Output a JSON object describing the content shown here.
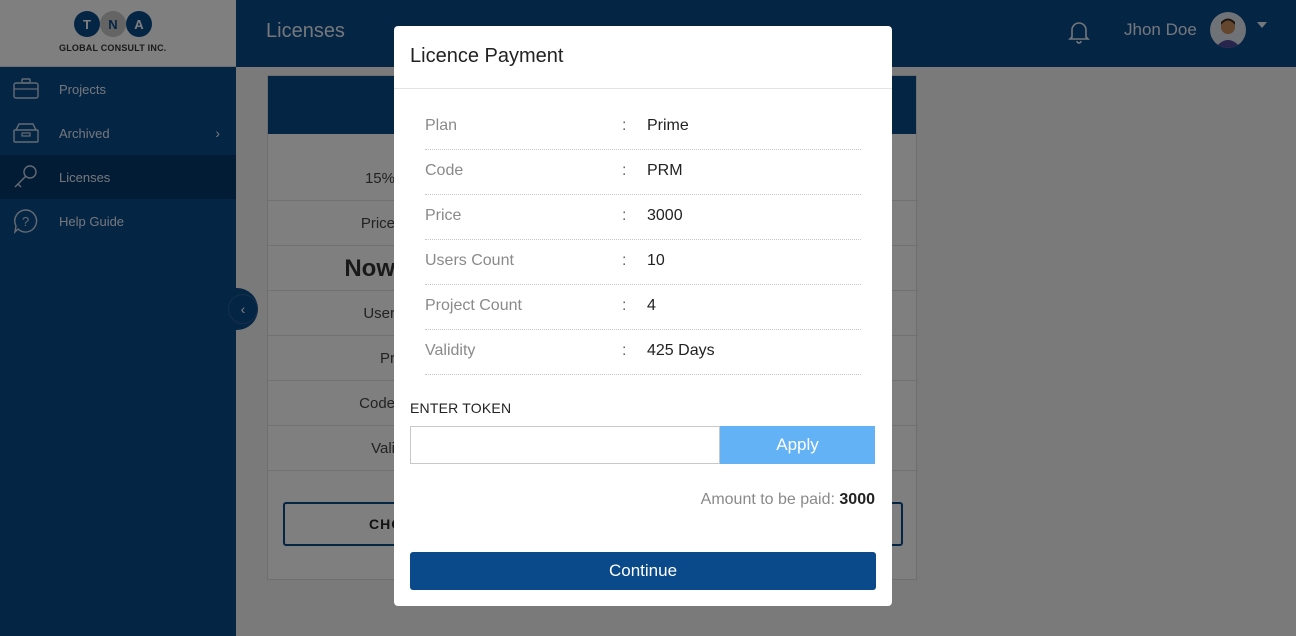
{
  "logo": {
    "letters": [
      "T",
      "N",
      "A"
    ],
    "company": "GLOBAL CONSULT INC."
  },
  "sidebar": {
    "items": [
      {
        "label": "Projects",
        "icon": "briefcase-icon"
      },
      {
        "label": "Archived",
        "icon": "archive-icon",
        "has_arrow": true
      },
      {
        "label": "Licenses",
        "icon": "key-icon",
        "active": true
      },
      {
        "label": "Help Guide",
        "icon": "help-icon"
      }
    ]
  },
  "topbar": {
    "title": "Licenses",
    "user_name": "Jhon Doe"
  },
  "background_card": {
    "rows": [
      "15%",
      "Price",
      "Now",
      "User",
      "Pr",
      "Code",
      "Vali"
    ],
    "button_label": "CHO"
  },
  "modal": {
    "title": "Licence Payment",
    "details": [
      {
        "label": "Plan",
        "value": "Prime"
      },
      {
        "label": "Code",
        "value": "PRM"
      },
      {
        "label": "Price",
        "value": "3000"
      },
      {
        "label": "Users Count",
        "value": "10"
      },
      {
        "label": "Project Count",
        "value": "4"
      },
      {
        "label": "Validity",
        "value": "425 Days"
      }
    ],
    "separator": ":",
    "token_label": "ENTER TOKEN",
    "token_value": "",
    "apply_label": "Apply",
    "amount_label": "Amount to be paid:",
    "amount_value": "3000",
    "continue_label": "Continue"
  },
  "colors": {
    "primary": "#0a4a8a",
    "apply": "#64b2f6",
    "overlay": "rgba(0,0,0,0.5)"
  }
}
